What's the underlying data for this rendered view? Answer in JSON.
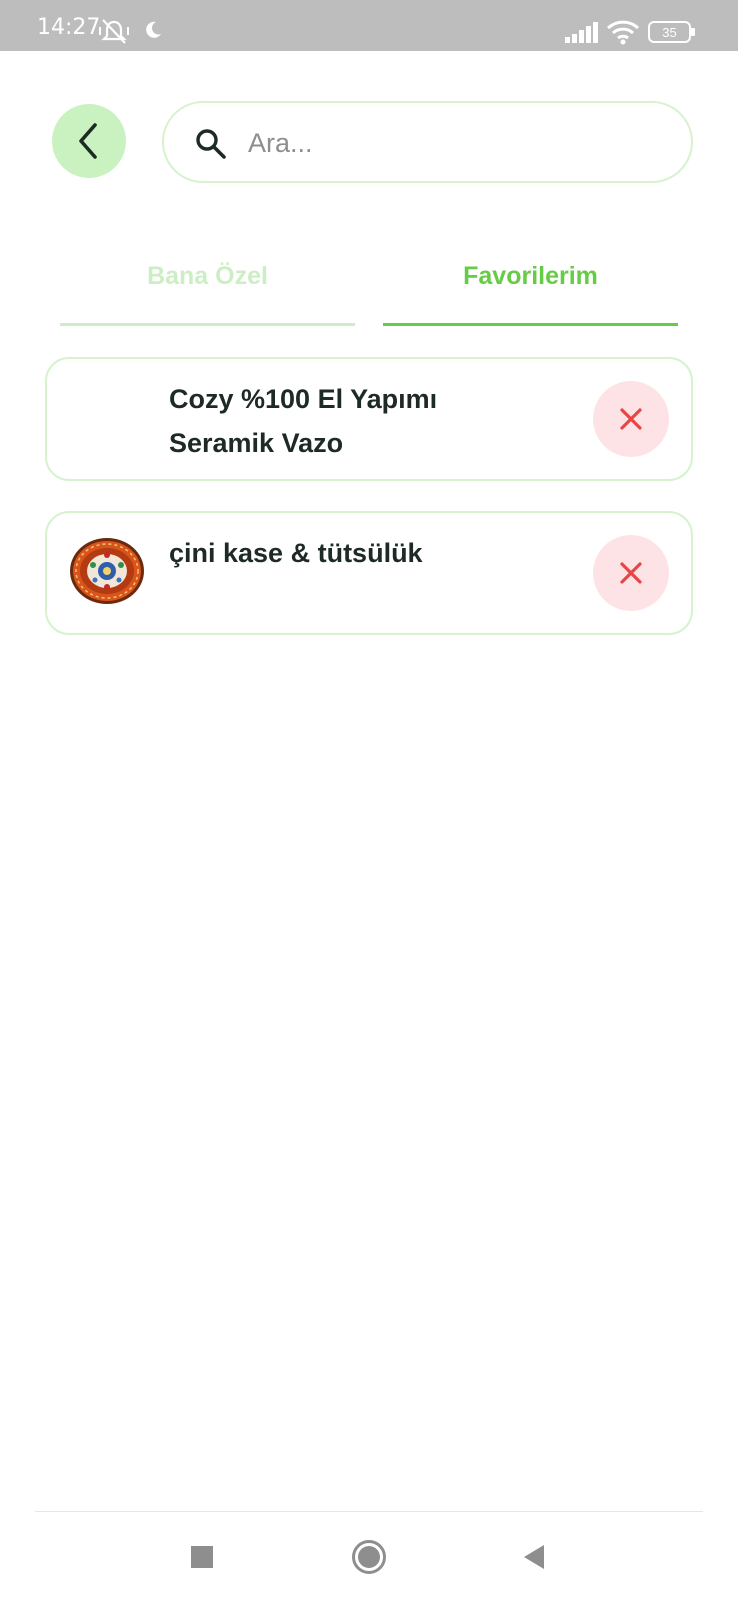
{
  "status_bar": {
    "time": "14:27",
    "battery_level": "35",
    "icons": [
      "mute-vibrate-icon",
      "moon-icon",
      "signal-icon",
      "wifi-icon",
      "battery-icon"
    ]
  },
  "header": {
    "back_icon": "chevron-left-icon",
    "search": {
      "icon": "search-icon",
      "placeholder": "Ara...",
      "value": ""
    }
  },
  "tabs": [
    {
      "label": "Bana Özel",
      "active": false
    },
    {
      "label": "Favorilerim",
      "active": true
    }
  ],
  "favorites": [
    {
      "title": "Cozy %100 El Yapımı Seramik Vazo",
      "has_image": false,
      "remove_icon": "close-icon"
    },
    {
      "title": "çini kase & tütsülük",
      "has_image": true,
      "image": "ceramic-bowl-image",
      "remove_icon": "close-icon"
    }
  ],
  "nav_bar": {
    "icons": [
      "recent-apps-icon",
      "home-icon",
      "back-triangle-icon"
    ]
  },
  "colors": {
    "accent_green": "#67cc45",
    "light_green": "#cdeec5",
    "back_button_bg": "#c9f2c0",
    "remove_bg": "#fde3e6",
    "remove_icon": "#e84545",
    "status_bar_bg": "#bdbdbd"
  }
}
